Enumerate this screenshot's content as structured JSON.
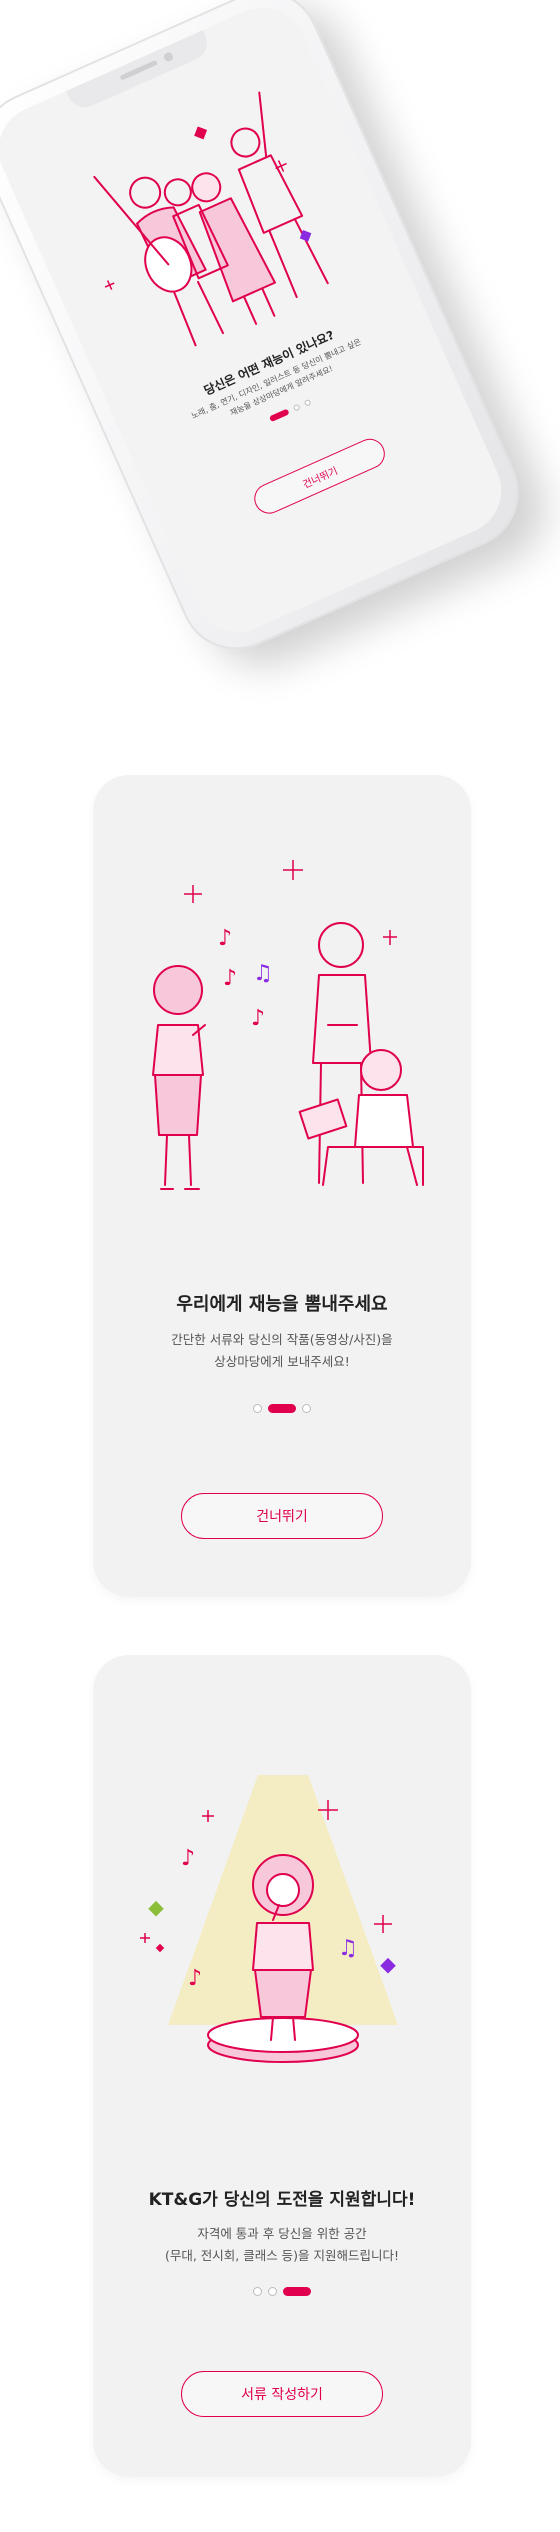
{
  "colors": {
    "accent": "#e0004e",
    "screen_bg": "#f2f2f3",
    "spotlight": "#f5ea9a"
  },
  "screens": [
    {
      "title": "당신은 어떤 재능이 있나요?",
      "desc_line1": "노래, 춤, 연기, 디자인, 일러스트 등 당신이 뽐내고 싶은",
      "desc_line2": "재능을 상상마당에게 알려주세요!",
      "button": "건너뛰기",
      "active_dot": 0
    },
    {
      "title": "우리에게 재능을 뽐내주세요",
      "desc_line1": "간단한 서류와 당신의 작품(동영상/사진)을",
      "desc_line2": "상상마당에게 보내주세요!",
      "button": "건너뛰기",
      "active_dot": 1
    },
    {
      "title": "KT&G가 당신의 도전을 지원합니다!",
      "desc_line1": "자격에 통과 후 당신을 위한 공간",
      "desc_line2": "(무대, 전시회, 클래스 등)을 지원해드립니다!",
      "button": "서류 작성하기",
      "active_dot": 2
    }
  ],
  "icons": {
    "sparkle": "sparkle-icon",
    "music_note": "music-note-icon",
    "diamond": "diamond-icon"
  }
}
